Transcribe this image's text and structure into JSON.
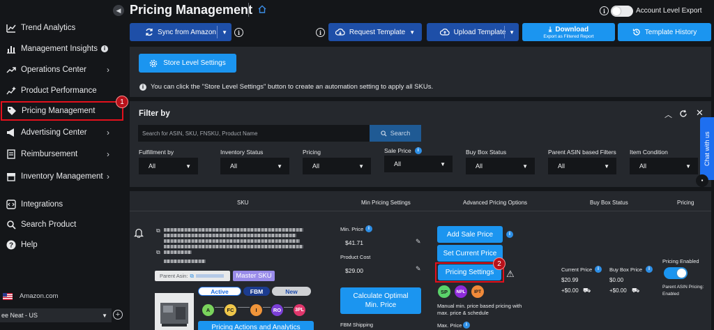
{
  "sidebar": {
    "items": [
      {
        "label": "Trend Analytics",
        "icon": "chart-line-icon"
      },
      {
        "label": "Management Insights",
        "icon": "bar-chart-icon"
      },
      {
        "label": "Operations Center",
        "icon": "trend-up-icon"
      },
      {
        "label": "Product Performance",
        "icon": "sparkle-chart-icon"
      },
      {
        "label": "Pricing Management",
        "icon": "price-tag-icon"
      },
      {
        "label": "Advertising Center",
        "icon": "megaphone-icon"
      },
      {
        "label": "Reimbursement",
        "icon": "receipt-icon"
      },
      {
        "label": "Inventory Management",
        "icon": "box-icon"
      },
      {
        "label": "Integrations",
        "icon": "integrations-icon"
      },
      {
        "label": "Search Product",
        "icon": "search-icon"
      },
      {
        "label": "Help",
        "icon": "help-icon"
      }
    ],
    "marketplace": "Amazon.com",
    "store": "ee Neat - US",
    "badge_1": "1"
  },
  "header": {
    "title": "Pricing Management",
    "account_export_label": "Account Level Export"
  },
  "toolbar": {
    "sync": "Sync from Amazon",
    "request_template": "Request Template",
    "upload_template": "Upload Template",
    "download": "Download",
    "download_sub": "Export as Filtered Report",
    "template_history": "Template History"
  },
  "store_settings": {
    "button": "Store Level Settings",
    "hint": "You can click the \"Store Level Settings\" button to create an automation setting to apply all SKUs."
  },
  "filter": {
    "title": "Filter by",
    "search_placeholder": "Search for ASIN, SKU, FNSKU, Product Name",
    "search_button": "Search",
    "fields": [
      {
        "label": "Fulfillment by",
        "value": "All"
      },
      {
        "label": "Inventory Status",
        "value": "All"
      },
      {
        "label": "Pricing",
        "value": "All"
      },
      {
        "label": "Sale Price",
        "value": "All"
      },
      {
        "label": "Buy Box Status",
        "value": "All"
      },
      {
        "label": "Parent ASIN based Filters",
        "value": "All"
      },
      {
        "label": "Item Condition",
        "value": "All"
      }
    ]
  },
  "chat": {
    "label": "Chat with us"
  },
  "table": {
    "headers": [
      "SKU",
      "Min Pricing Settings",
      "Advanced Pricing Options",
      "Buy Box Status",
      "Pricing"
    ],
    "row": {
      "parent_asin_label": "Parent Asin:",
      "master_sku": "Master SKU",
      "statuses": [
        "Active",
        "FBM",
        "New"
      ],
      "tags": [
        "A",
        "FC",
        "I",
        "RO",
        "3PL"
      ],
      "min_price_label": "Min. Price",
      "min_price": "$41.71",
      "product_cost_label": "Product Cost",
      "product_cost": "$29.00",
      "calc_button": "Calculate Optimal Min. Price",
      "fbm_shipping_label": "FBM Shipping",
      "add_sale_price": "Add Sale Price",
      "set_current_price": "Set Current Price",
      "pricing_settings": "Pricing Settings",
      "badge_2": "2",
      "strategy_tags": [
        "SP",
        "NPL",
        "IPT"
      ],
      "manual_note": "Manual min. price based pricing with max. price & schedule",
      "max_price_label": "Max. Price",
      "current_price_label": "Current Price",
      "current_price": "$20.99",
      "current_ship": "+$0.00",
      "buy_box_price_label": "Buy Box Price",
      "buy_box_price": "$0.00",
      "buy_box_ship": "+$0.00",
      "pricing_enabled_label": "Pricing Enabled",
      "parent_asin_pricing": "Parent ASIN Pricing:",
      "parent_asin_pricing_value": "Enabled",
      "actions_button": "Pricing Actions and Analytics"
    }
  }
}
